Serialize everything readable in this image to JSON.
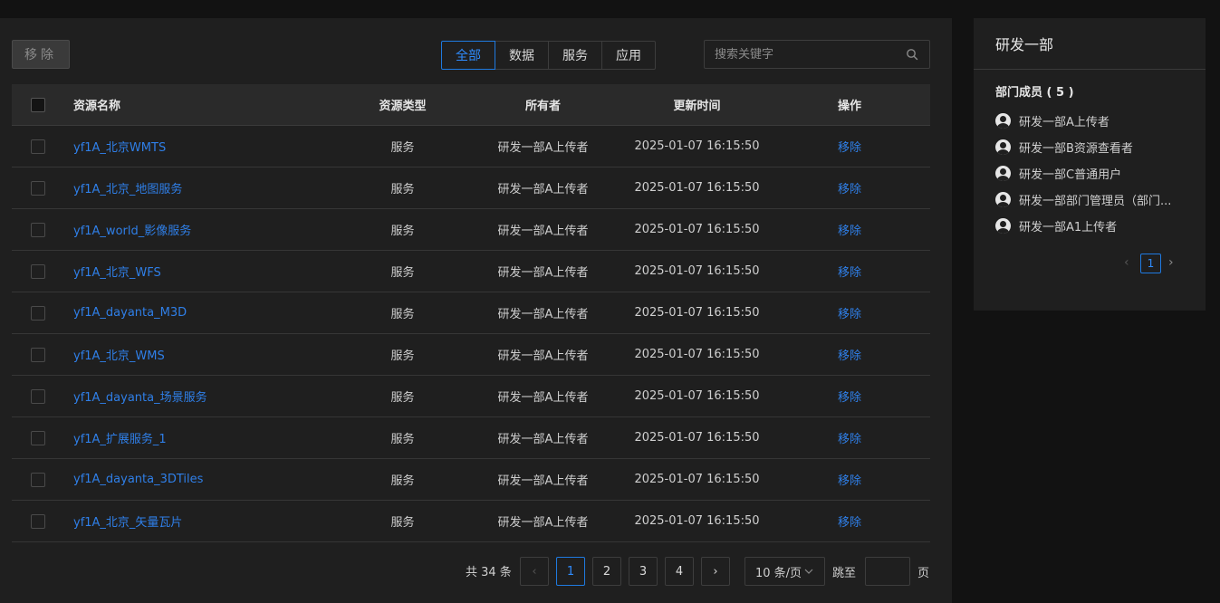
{
  "toolbar": {
    "remove_label": "移除",
    "tabs": [
      {
        "label": "全部",
        "active": true
      },
      {
        "label": "数据",
        "active": false
      },
      {
        "label": "服务",
        "active": false
      },
      {
        "label": "应用",
        "active": false
      }
    ],
    "search_placeholder": "搜索关键字"
  },
  "table": {
    "headers": {
      "name": "资源名称",
      "type": "资源类型",
      "owner": "所有者",
      "time": "更新时间",
      "op": "操作"
    },
    "rows": [
      {
        "name": "yf1A_北京WMTS",
        "type": "服务",
        "owner": "研发一部A上传者",
        "time": "2025-01-07 16:15:50",
        "op": "移除"
      },
      {
        "name": "yf1A_北京_地图服务",
        "type": "服务",
        "owner": "研发一部A上传者",
        "time": "2025-01-07 16:15:50",
        "op": "移除"
      },
      {
        "name": "yf1A_world_影像服务",
        "type": "服务",
        "owner": "研发一部A上传者",
        "time": "2025-01-07 16:15:50",
        "op": "移除"
      },
      {
        "name": "yf1A_北京_WFS",
        "type": "服务",
        "owner": "研发一部A上传者",
        "time": "2025-01-07 16:15:50",
        "op": "移除"
      },
      {
        "name": "yf1A_dayanta_M3D",
        "type": "服务",
        "owner": "研发一部A上传者",
        "time": "2025-01-07 16:15:50",
        "op": "移除"
      },
      {
        "name": "yf1A_北京_WMS",
        "type": "服务",
        "owner": "研发一部A上传者",
        "time": "2025-01-07 16:15:50",
        "op": "移除"
      },
      {
        "name": "yf1A_dayanta_场景服务",
        "type": "服务",
        "owner": "研发一部A上传者",
        "time": "2025-01-07 16:15:50",
        "op": "移除"
      },
      {
        "name": "yf1A_扩展服务_1",
        "type": "服务",
        "owner": "研发一部A上传者",
        "time": "2025-01-07 16:15:50",
        "op": "移除"
      },
      {
        "name": "yf1A_dayanta_3DTiles",
        "type": "服务",
        "owner": "研发一部A上传者",
        "time": "2025-01-07 16:15:50",
        "op": "移除"
      },
      {
        "name": "yf1A_北京_矢量瓦片",
        "type": "服务",
        "owner": "研发一部A上传者",
        "time": "2025-01-07 16:15:50",
        "op": "移除"
      }
    ]
  },
  "pagination": {
    "total_text": "共 34 条",
    "pages": [
      "1",
      "2",
      "3",
      "4"
    ],
    "current": "1",
    "prev_glyph": "‹",
    "next_glyph": "›",
    "page_size": "10 条/页",
    "jump_label": "跳至",
    "page_suffix": "页"
  },
  "side": {
    "title": "研发一部",
    "members_title": "部门成员 ( 5 )",
    "members": [
      "研发一部A上传者",
      "研发一部B资源查看者",
      "研发一部C普通用户",
      "研发一部部门管理员（部门...",
      "研发一部A1上传者"
    ],
    "pager": {
      "prev_glyph": "‹",
      "current": "1",
      "next_glyph": "›"
    }
  }
}
